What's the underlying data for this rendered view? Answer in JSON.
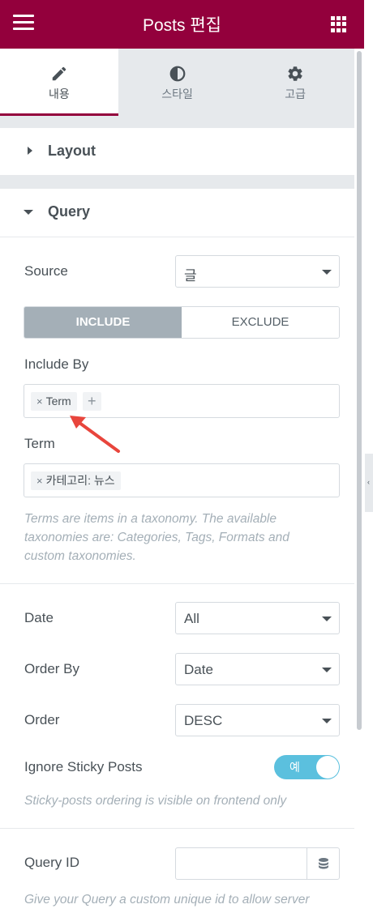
{
  "header": {
    "title": "Posts 편집"
  },
  "tabs": [
    {
      "label": "내용",
      "icon": "pencil-icon",
      "active": true
    },
    {
      "label": "스타일",
      "icon": "half-circle-icon",
      "active": false
    },
    {
      "label": "고급",
      "icon": "gear-icon",
      "active": false
    }
  ],
  "sections": {
    "layout": {
      "label": "Layout"
    },
    "query": {
      "label": "Query"
    }
  },
  "source": {
    "label": "Source",
    "value": "글"
  },
  "include_exclude": {
    "include": "INCLUDE",
    "exclude": "EXCLUDE",
    "active": "INCLUDE"
  },
  "include_by": {
    "label": "Include By",
    "chips": [
      "Term"
    ],
    "add_symbol": "+"
  },
  "term": {
    "label": "Term",
    "chips": [
      "카테고리: 뉴스"
    ]
  },
  "term_note": "Terms are items in a taxonomy. The available taxonomies are: Categories, Tags, Formats and custom taxonomies.",
  "date": {
    "label": "Date",
    "value": "All"
  },
  "order_by": {
    "label": "Order By",
    "value": "Date"
  },
  "order": {
    "label": "Order",
    "value": "DESC"
  },
  "ignore_sticky": {
    "label": "Ignore Sticky Posts",
    "toggle_text": "예",
    "on": true
  },
  "sticky_note": "Sticky-posts ordering is visible on frontend only",
  "query_id": {
    "label": "Query ID",
    "value": ""
  },
  "query_id_note": "Give your Query a custom unique id to allow server",
  "chip_remove_symbol": "×",
  "colors": {
    "brand": "#93003c",
    "toggle": "#5bc0de",
    "annotation_arrow": "#e8453c"
  }
}
